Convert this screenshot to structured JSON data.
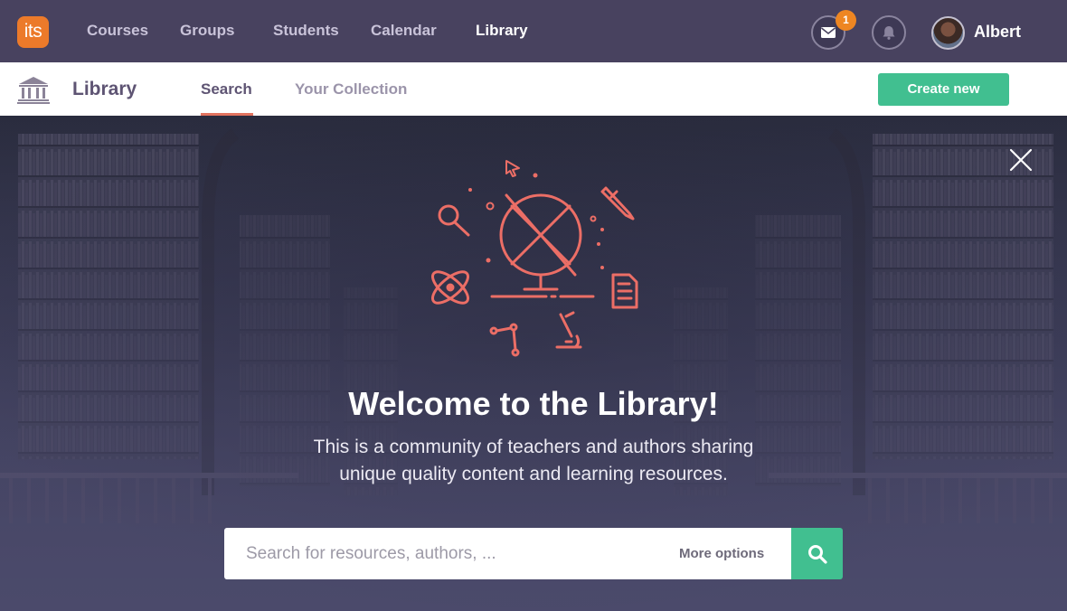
{
  "topbar": {
    "logo_text": "its",
    "nav": [
      {
        "label": "Courses"
      },
      {
        "label": "Groups"
      },
      {
        "label": "Students"
      },
      {
        "label": "Calendar"
      },
      {
        "label": "Library",
        "active": true
      }
    ],
    "messages_badge": "1",
    "user_name": "Albert",
    "icons": {
      "messages": "envelope-icon",
      "notifications": "bell-icon"
    }
  },
  "subheader": {
    "title": "Library",
    "tabs": [
      {
        "label": "Search",
        "active": true
      },
      {
        "label": "Your Collection"
      }
    ],
    "create_button": "Create new"
  },
  "hero": {
    "title": "Welcome to the Library!",
    "subtitle": "This is a community of teachers and authors sharing unique quality content and learning resources.",
    "search_placeholder": "Search for resources, authors, ...",
    "more_options": "More options"
  },
  "colors": {
    "topbar_bg": "#48425f",
    "accent_green": "#41bf90",
    "accent_orange": "#ec7a2a",
    "illustration": "#ec6e66"
  }
}
